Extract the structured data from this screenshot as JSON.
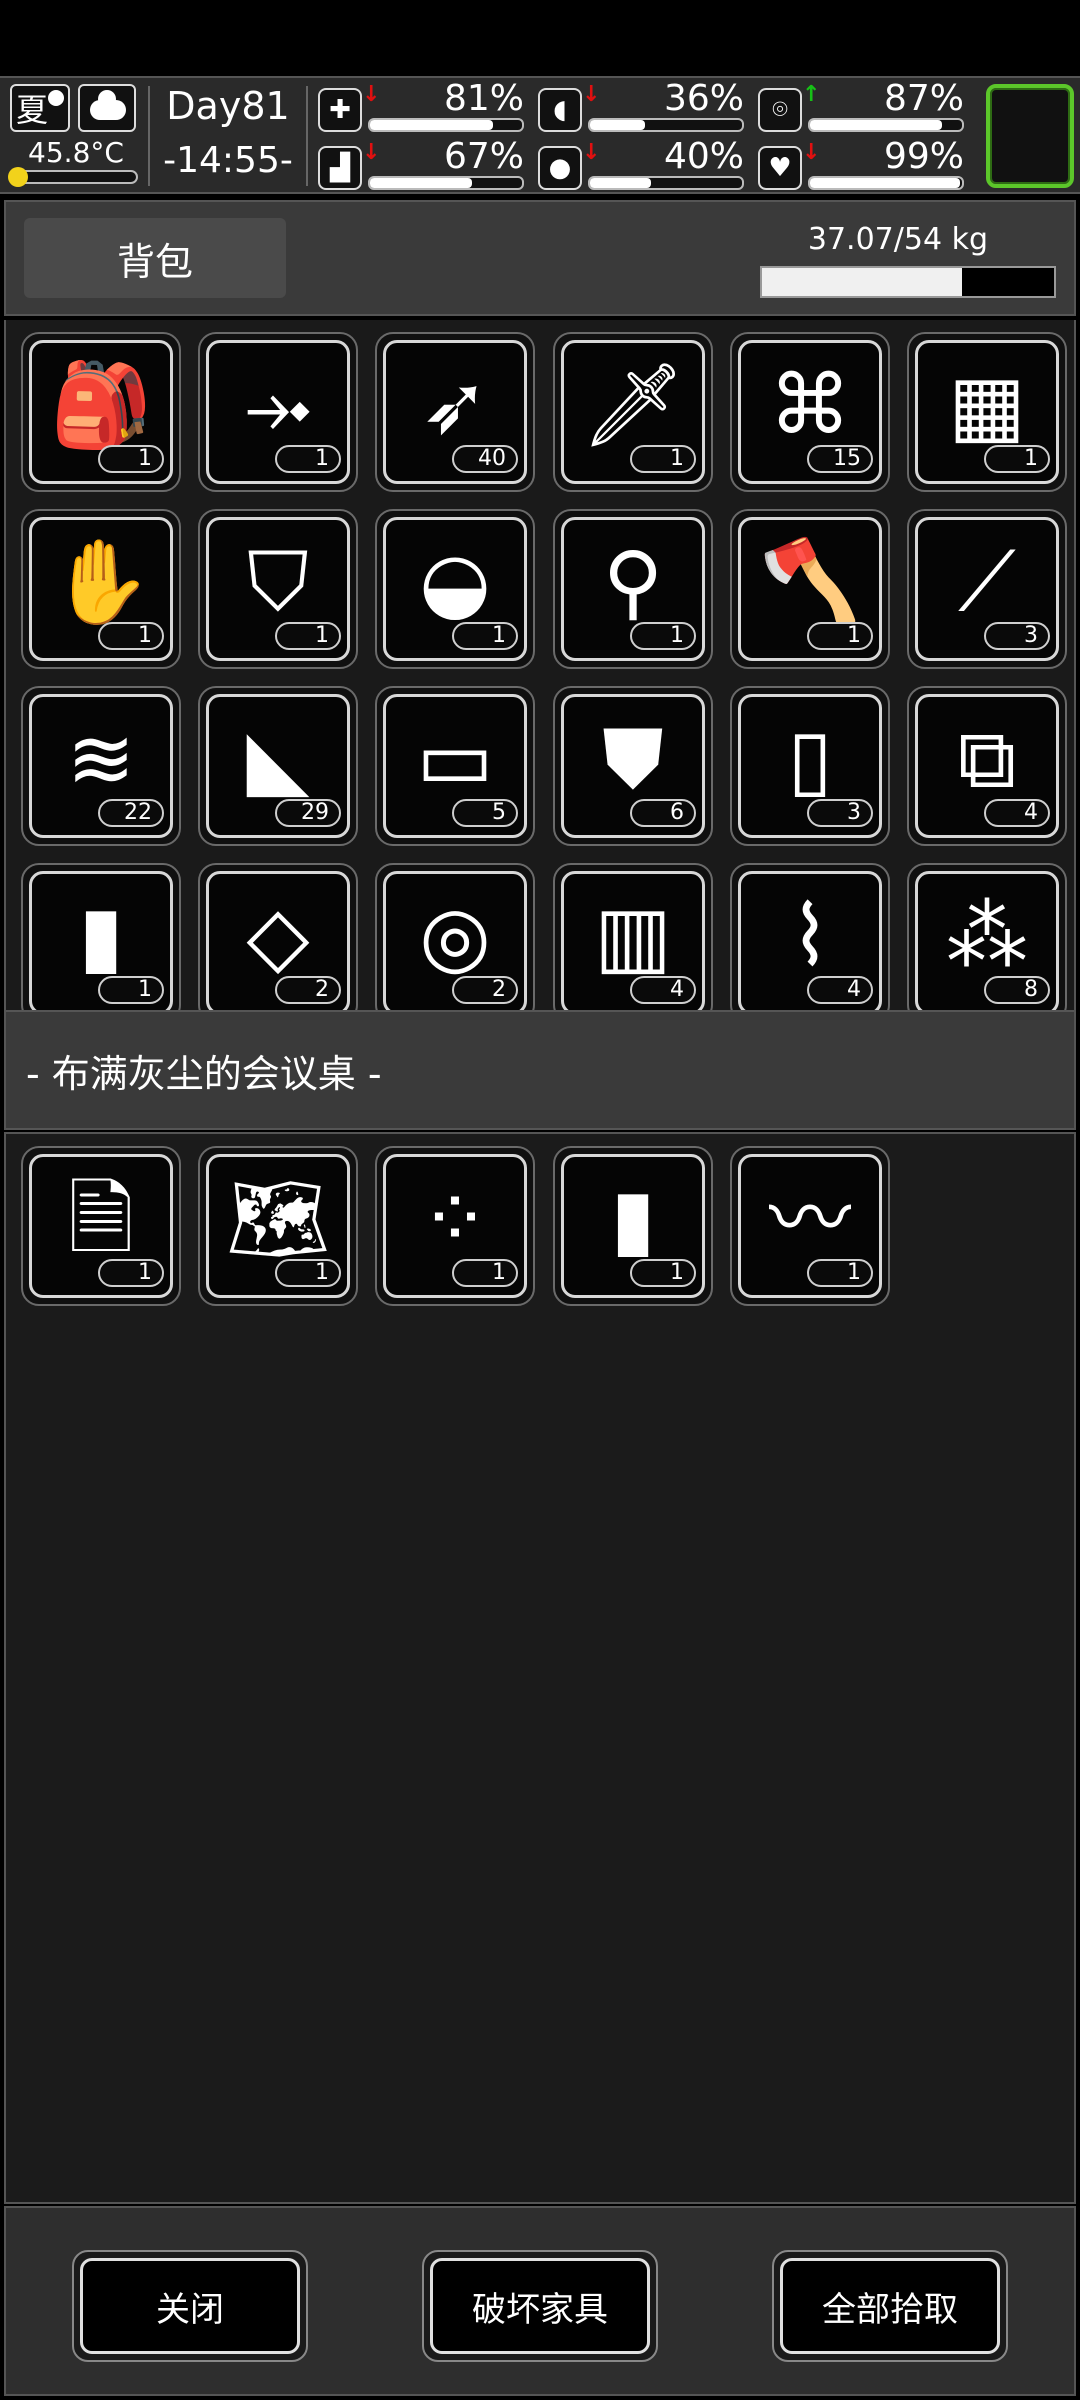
{
  "status": {
    "season": "夏",
    "temperature": "45.8°C",
    "temperature_level": 0.12,
    "day": "Day81",
    "time": "-14:55-",
    "stats": [
      {
        "icon": "medkit-icon",
        "glyph": "✚",
        "arrow": "↓",
        "arrow_color": "#e01010",
        "value": "81%",
        "level": 0.81
      },
      {
        "icon": "stomach-icon",
        "glyph": "◖",
        "arrow": "↓",
        "arrow_color": "#e01010",
        "value": "36%",
        "level": 0.36
      },
      {
        "icon": "bottle-icon",
        "glyph": "⌾",
        "arrow": "↑",
        "arrow_color": "#16c016",
        "value": "87%",
        "level": 0.87
      },
      {
        "icon": "boot-icon",
        "glyph": "▟",
        "arrow": "↓",
        "arrow_color": "#e01010",
        "value": "67%",
        "level": 0.67
      },
      {
        "icon": "water-drop-icon",
        "glyph": "●",
        "arrow": "↓",
        "arrow_color": "#e01010",
        "value": "40%",
        "level": 0.4
      },
      {
        "icon": "heart-icon",
        "glyph": "♥",
        "arrow": "↓",
        "arrow_color": "#e01010",
        "value": "99%",
        "level": 0.99
      }
    ],
    "accent_color": "#5cc72a"
  },
  "backpack": {
    "tab_label": "背包",
    "weight_text": "37.07/54 kg",
    "weight_level": 0.686,
    "items": [
      {
        "icon": "backpack-icon",
        "glyph": "🎒",
        "count": "1"
      },
      {
        "icon": "crossbow-icon",
        "glyph": "⤞",
        "count": "1"
      },
      {
        "icon": "arrow-icon",
        "glyph": "➶",
        "count": "40"
      },
      {
        "icon": "machete-icon",
        "glyph": "🗡",
        "count": "1"
      },
      {
        "icon": "net-icon",
        "glyph": "⌘",
        "count": "15"
      },
      {
        "icon": "phone-keypad-icon",
        "glyph": "▦",
        "count": "1"
      },
      {
        "icon": "gloves-icon",
        "glyph": "✋",
        "count": "1"
      },
      {
        "icon": "vest-icon",
        "glyph": "⛉",
        "count": "1"
      },
      {
        "icon": "hat-icon",
        "glyph": "◒",
        "count": "1"
      },
      {
        "icon": "shovel-icon",
        "glyph": "⚲",
        "count": "1"
      },
      {
        "icon": "axe-icon",
        "glyph": "🪓",
        "count": "1"
      },
      {
        "icon": "lockpick-icon",
        "glyph": "⟋",
        "count": "3"
      },
      {
        "icon": "folded-cloth-icon",
        "glyph": "≋",
        "count": "22"
      },
      {
        "icon": "burrito-icon",
        "glyph": "◣",
        "count": "29"
      },
      {
        "icon": "towel-icon",
        "glyph": "▭",
        "count": "5"
      },
      {
        "icon": "rag-shirt-icon",
        "glyph": "⛊",
        "count": "6"
      },
      {
        "icon": "cloth-sheet-icon",
        "glyph": "▯",
        "count": "3"
      },
      {
        "icon": "bandage-icon",
        "glyph": "⧉",
        "count": "4"
      },
      {
        "icon": "tape-roll-icon",
        "glyph": "▮",
        "count": "1"
      },
      {
        "icon": "tray-icon",
        "glyph": "◇",
        "count": "2"
      },
      {
        "icon": "logs-icon",
        "glyph": "◎",
        "count": "2"
      },
      {
        "icon": "wood-planks-icon",
        "glyph": "▥",
        "count": "4"
      },
      {
        "icon": "plastic-bottle-icon",
        "glyph": "⌇",
        "count": "4"
      },
      {
        "icon": "rubble-icon",
        "glyph": "⁂",
        "count": "8"
      }
    ]
  },
  "container": {
    "title": "- 布满灰尘的会议桌 -",
    "items": [
      {
        "icon": "document-icon",
        "glyph": "🗎",
        "count": "1"
      },
      {
        "icon": "map-scroll-icon",
        "glyph": "🗺",
        "count": "1"
      },
      {
        "icon": "beads-icon",
        "glyph": "⁘",
        "count": "1"
      },
      {
        "icon": "tape-roll-icon",
        "glyph": "▮",
        "count": "1"
      },
      {
        "icon": "bandage-roll-icon",
        "glyph": "〰",
        "count": "1"
      }
    ]
  },
  "footer": {
    "close_label": "关闭",
    "destroy_label": "破坏家具",
    "take_all_label": "全部拾取"
  }
}
